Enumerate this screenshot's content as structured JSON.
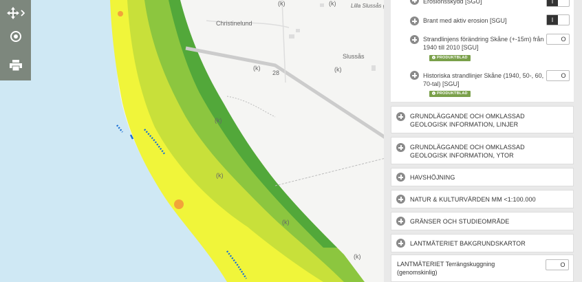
{
  "map": {
    "labels": {
      "christinelund": "Christinelund",
      "lilla_sluss": "Lilla Slussås g",
      "slussas": "Slussås",
      "road_28": "28",
      "k": "(k)"
    },
    "colors": {
      "sea": "#cfe8f4",
      "land": "#f4f4f2",
      "green_dark": "#52a83a",
      "green": "#8cc63f",
      "yellow": "#f0f53a",
      "orange": "#f2a33a"
    }
  },
  "toolbar": {
    "pan_icon": "move-icon",
    "locate_icon": "target-icon",
    "print_icon": "printer-icon"
  },
  "panel": {
    "sublayers": [
      {
        "label": "Erosionsskydd [SGU]",
        "state": "on",
        "on_text": "I",
        "off_text": ""
      },
      {
        "label": "Brant med aktiv erosion [SGU]",
        "state": "on",
        "on_text": "I",
        "off_text": ""
      },
      {
        "label": "Strandlinjens förändring Skåne (+-15m) från 1940 till 2010 [SGU]",
        "state": "off",
        "off_text": "O",
        "badge": "PRODUKTBLAD"
      },
      {
        "label": "Historiska strandlinjer Skåne (1940, 50-, 60, 70-tal) [SGU]",
        "state": "off",
        "off_text": "O",
        "badge": "PRODUKTBLAD"
      }
    ],
    "groups": [
      {
        "label": "GRUNDLÄGGANDE OCH OMKLASSAD GEOLOGISK INFORMATION, LINJER"
      },
      {
        "label": "GRUNDLÄGGANDE OCH OMKLASSAD GEOLOGISK INFORMATION, YTOR"
      },
      {
        "label": "HAVSHÖJNING"
      },
      {
        "label": "NATUR & KULTURVÄRDEN MM <1:100.000"
      },
      {
        "label": "GRÄNSER OCH STUDIEOMRÅDE"
      },
      {
        "label": "LANTMÄTERIET BAKGRUNDSKARTOR"
      }
    ],
    "bottom_layer": {
      "label_bold": "LANTMÄTERIET",
      "label_rest": " Terrängskuggning (genomskinlig)",
      "off_text": "O"
    }
  }
}
